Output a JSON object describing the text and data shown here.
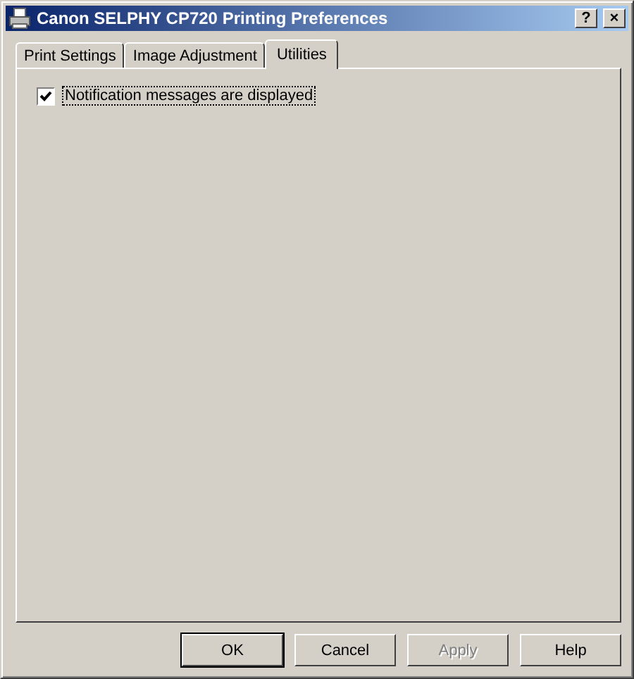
{
  "window": {
    "title": "Canon SELPHY CP720 Printing Preferences",
    "title_buttons": [
      "?",
      "×"
    ]
  },
  "tabs": [
    {
      "label": "Print Settings",
      "selected": false
    },
    {
      "label": "Image Adjustment",
      "selected": false
    },
    {
      "label": "Utilities",
      "selected": true
    }
  ],
  "options": [
    {
      "label": "Notification messages are displayed",
      "checked": true
    }
  ],
  "buttons": [
    {
      "label": "OK",
      "default": true,
      "disabled": false
    },
    {
      "label": "Cancel",
      "default": false,
      "disabled": false
    },
    {
      "label": "Apply",
      "default": false,
      "disabled": true
    },
    {
      "label": "Help",
      "default": false,
      "disabled": false
    }
  ]
}
